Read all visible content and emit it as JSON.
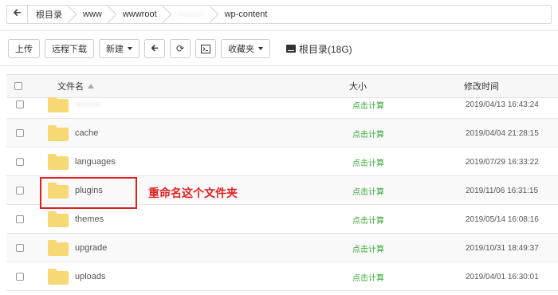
{
  "breadcrumb": {
    "items": [
      "根目录",
      "www",
      "wwwroot",
      "wp-content"
    ],
    "blurred_item": "·········"
  },
  "toolbar": {
    "upload": "上传",
    "remote_download": "远程下载",
    "new": "新建",
    "favorites": "收藏夹",
    "disk": "根目录(18G)"
  },
  "table": {
    "headers": {
      "name": "文件名",
      "size": "大小",
      "mtime": "修改时间"
    },
    "rows": [
      {
        "name": "·········",
        "size": "点击计算",
        "mtime": "2019/04/13 16:43:24"
      },
      {
        "name": "cache",
        "size": "点击计算",
        "mtime": "2019/04/04 21:28:15"
      },
      {
        "name": "languages",
        "size": "点击计算",
        "mtime": "2019/07/29 16:33:22"
      },
      {
        "name": "plugins",
        "size": "点击计算",
        "mtime": "2019/11/06 16:31:15"
      },
      {
        "name": "themes",
        "size": "点击计算",
        "mtime": "2019/05/14 16:08:16"
      },
      {
        "name": "upgrade",
        "size": "点击计算",
        "mtime": "2019/10/31 18:49:37"
      },
      {
        "name": "uploads",
        "size": "点击计算",
        "mtime": "2019/04/01 16:30:01"
      }
    ]
  },
  "annotation": "重命名这个文件夹",
  "colors": {
    "calc": "#3aa63a",
    "folder": "#f8d775",
    "annotation": "#e02020"
  }
}
